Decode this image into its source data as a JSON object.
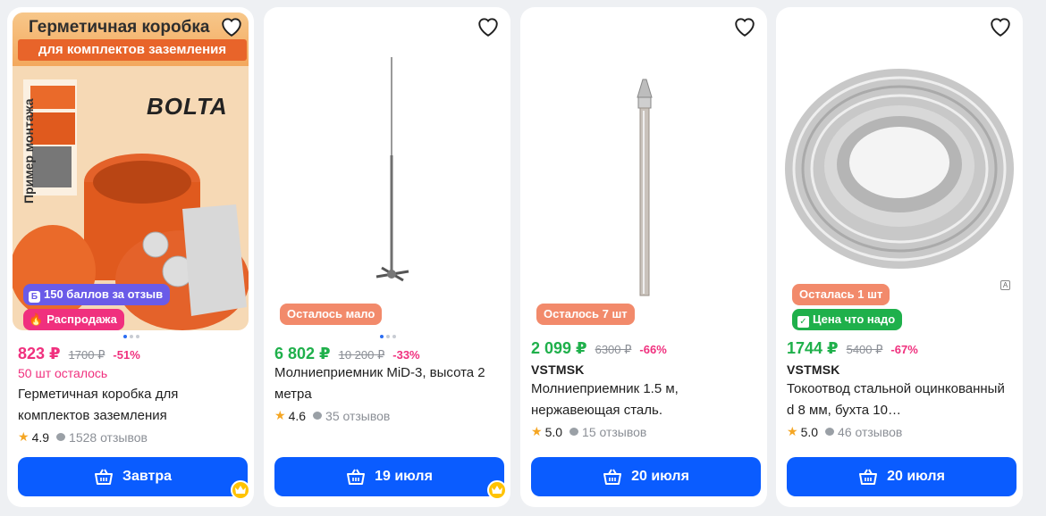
{
  "colors": {
    "buy_button": "#0a5cff",
    "price_pink": "#f0307e",
    "price_green": "#1fb04b",
    "stock_tag": "#f28a6b",
    "good_price_tag": "#1fb04b",
    "points_tag": "#6a5be8",
    "sale_tag": "#f0307e"
  },
  "cards": [
    {
      "promo": {
        "title": "Герметичная коробка",
        "subtitle": "для комплектов заземления",
        "side_text": "Пример монтажа",
        "logo": "BOLTA"
      },
      "points_badge": "150 баллов за отзыв",
      "sale_badge": "Распродажа",
      "price": "823 ₽",
      "old_price": "1700 ₽",
      "discount": "-51%",
      "stock_text": "50 шт осталось",
      "title": "Герметичная коробка для комплектов заземления",
      "rating": "4.9",
      "reviews": "1528 отзывов",
      "buy_label": "Завтра",
      "icons": {
        "favorite": "heart-icon",
        "basket": "basket-icon",
        "crown": "crown-icon",
        "fire": "fire-icon"
      }
    },
    {
      "stock_badge": "Осталось мало",
      "price": "6 802 ₽",
      "old_price": "10 200 ₽",
      "discount": "-33%",
      "title": "Молниеприемник MiD-3, высота 2 метра",
      "rating": "4.6",
      "reviews": "35 отзывов",
      "buy_label": "19 июля"
    },
    {
      "stock_badge": "Осталось 7 шт",
      "price": "2 099 ₽",
      "old_price": "6300 ₽",
      "discount": "-66%",
      "brand": "VSTMSK",
      "title": "Молниеприемник 1.5 м, нержавеющая сталь.",
      "rating": "5.0",
      "reviews": "15 отзывов",
      "buy_label": "20 июля"
    },
    {
      "stock_badge": "Осталась 1 шт",
      "good_price_badge": "Цена что надо",
      "price": "1744 ₽",
      "old_price": "5400 ₽",
      "discount": "-67%",
      "brand": "VSTMSK",
      "title": "Токоотвод стальной оцинкованный d 8 мм, бухта 10…",
      "rating": "5.0",
      "reviews": "46 отзывов",
      "buy_label": "20 июля"
    }
  ]
}
